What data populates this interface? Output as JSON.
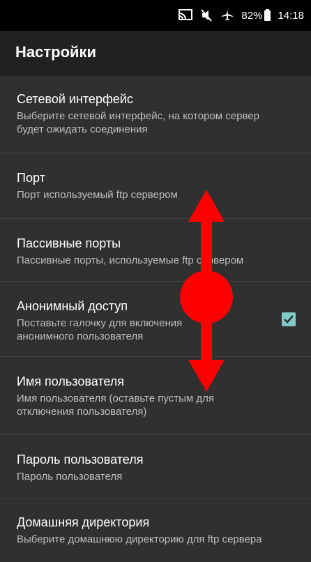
{
  "statusbar": {
    "icons": [
      "cast-icon",
      "mute-icon",
      "airplane-icon"
    ],
    "battery": "82%",
    "time": "14:18"
  },
  "toolbar": {
    "title": "Настройки"
  },
  "settings": [
    {
      "title": "Сетевой интерфейс",
      "summary": "Выберите сетевой интерфейс, на котором сервер будет ожидать соединения"
    },
    {
      "title": "Порт",
      "summary": "Порт используемый ftp сервером"
    },
    {
      "title": "Пассивные порты",
      "summary": "Пассивные порты, используемые ftp сервером"
    },
    {
      "title": "Анонимный доступ",
      "summary": "Поставьте галочку для включения анонимного пользователя",
      "checked": true
    },
    {
      "title": "Имя пользователя",
      "summary": "Имя пользователя (оставьте пустым для отключения пользователя)"
    },
    {
      "title": "Пароль пользователя",
      "summary": "Пароль пользователя"
    },
    {
      "title": "Домашняя директория",
      "summary": "Выберите домашнюю директорию для ftp сервера"
    }
  ],
  "colors": {
    "background": "#303030",
    "toolbar": "#212121",
    "checkbox": "#80cbc4",
    "gesture": "#ff0000"
  },
  "gesture": {
    "type": "swipe-vertical",
    "icon": "swipe-up-down-icon"
  }
}
